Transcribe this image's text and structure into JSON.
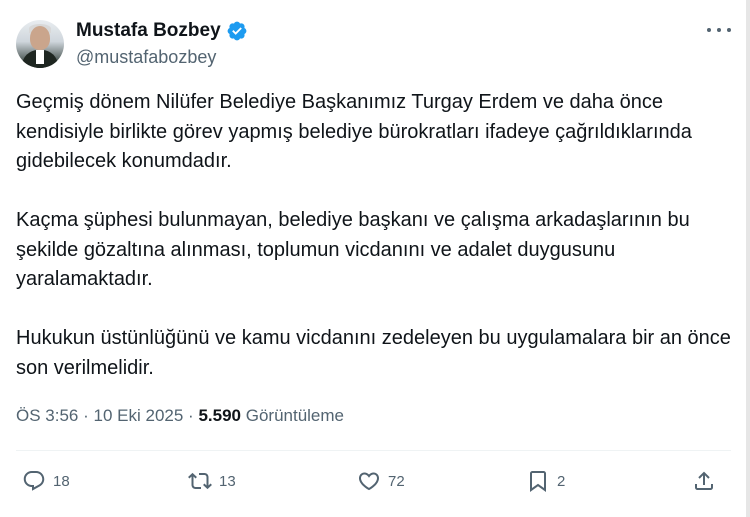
{
  "author": {
    "name": "Mustafa Bozbey",
    "handle": "@mustafabozbey",
    "verified_color": "#1d9bf0"
  },
  "tweet": {
    "paragraphs": [
      "Geçmiş dönem Nilüfer Belediye Başkanımız Turgay Erdem ve daha önce kendisiyle birlikte görev yapmış belediye bürokratları ifadeye çağrıldıklarında gidebilecek konumdadır.",
      "Kaçma şüphesi bulunmayan, belediye başkanı ve çalışma arkadaşlarının bu şekilde gözaltına alınması, toplumun vicdanını ve adalet duygusunu yaralamaktadır.",
      "Hukukun üstünlüğünü ve kamu vicdanını zedeleyen bu uygulamalara bir an önce son verilmelidir."
    ]
  },
  "meta": {
    "time": "ÖS 3:56",
    "separator": "·",
    "date": "10 Eki 2025",
    "views_count": "5.590",
    "views_label": "Görüntüleme"
  },
  "actions": {
    "replies": "18",
    "reposts": "13",
    "likes": "72",
    "bookmarks": "2"
  },
  "icons": [
    "verified-badge-icon",
    "more-icon",
    "reply-icon",
    "repost-icon",
    "like-icon",
    "bookmark-icon",
    "share-icon"
  ],
  "colors": {
    "text": "#0f1419",
    "secondary": "#536471",
    "accent": "#1d9bf0"
  }
}
